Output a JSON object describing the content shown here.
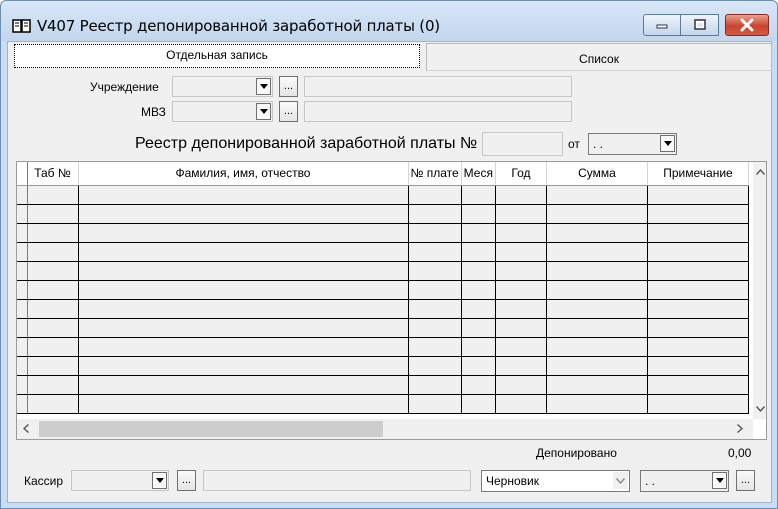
{
  "window": {
    "title": "V407 Реестр депонированной заработной платы (0)"
  },
  "tabs": [
    {
      "label": "Отдельная запись",
      "active": true
    },
    {
      "label": "Список",
      "active": false
    }
  ],
  "form": {
    "institution_label": "Учреждение",
    "mvz_label": "МВЗ",
    "registry_label": "Реестр депонированной заработной платы №",
    "registry_number": "",
    "from_label": "от",
    "from_date": ". .",
    "browse_label": "..."
  },
  "grid": {
    "columns": [
      "Таб №",
      "Фамилия, имя, отчество",
      "№ плате",
      "Меся",
      "Год",
      "Сумма",
      "Примечание"
    ],
    "row_count": 12
  },
  "footer": {
    "deposited_label": "Депонировано",
    "deposited_value": "0,00",
    "cashier_label": "Кассир",
    "status_value": "Черновик",
    "date_value": ". ."
  },
  "colors": {
    "frame": "#c9dcf1",
    "close_button": "#c9452f",
    "panel": "#f0f0f0"
  }
}
